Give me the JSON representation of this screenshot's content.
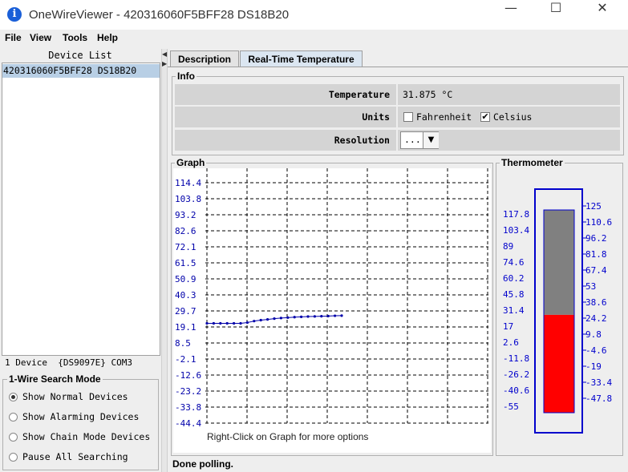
{
  "window": {
    "title": "OneWireViewer - 420316060F5BFF28 DS18B20",
    "icon_glyph": "i",
    "minimize_glyph": "—",
    "maximize_glyph": "☐",
    "close_glyph": "✕"
  },
  "menu": [
    "File",
    "View",
    "Tools",
    "Help"
  ],
  "device_list": {
    "header": "Device List",
    "items": [
      "420316060F5BFF28 DS18B20"
    ],
    "status": "1 Device  {DS9097E} COM3"
  },
  "search_mode": {
    "title": "1-Wire Search Mode",
    "options": [
      {
        "label": "Show Normal Devices",
        "selected": true
      },
      {
        "label": "Show Alarming Devices",
        "selected": false
      },
      {
        "label": "Show Chain Mode Devices",
        "selected": false
      },
      {
        "label": "Pause All Searching",
        "selected": false
      }
    ]
  },
  "splitter": {
    "left_arrow": "◀",
    "right_arrow": "▶"
  },
  "tabs": [
    {
      "label": "Description",
      "active": false
    },
    {
      "label": "Real-Time Temperature",
      "active": true
    }
  ],
  "info": {
    "title": "Info",
    "temperature_label": "Temperature",
    "temperature_value": "31.875 °C",
    "units_label": "Units",
    "fahrenheit_label": "Fahrenheit",
    "fahrenheit_checked": false,
    "celsius_label": "Celsius",
    "celsius_checked": true,
    "check_glyph": "✔",
    "resolution_label": "Resolution",
    "resolution_value": "...",
    "dropdown_glyph": "▼"
  },
  "graph": {
    "title": "Graph",
    "hint": "Right-Click on Graph for more options",
    "line_color": "#0000aa"
  },
  "chart_data": {
    "type": "line",
    "title": "",
    "xlabel": "",
    "ylabel": "",
    "y_tick_labels": [
      "114.4",
      "103.8",
      "93.2",
      "82.6",
      "72.1",
      "61.5",
      "50.9",
      "40.3",
      "29.7",
      "19.1",
      "8.5",
      "-2.1",
      "-12.6",
      "-23.2",
      "-33.8",
      "-44.4"
    ],
    "ylim": [
      -44.4,
      114.4
    ],
    "grid": true,
    "series": [
      {
        "values": [
          21.5,
          21.5,
          21.5,
          21.5,
          21.5,
          21.5,
          22.0,
          23.0,
          23.6,
          24.1,
          24.6,
          25.0,
          25.3,
          25.6,
          25.8,
          26.0,
          26.1,
          26.2,
          26.3,
          26.5,
          26.6
        ]
      }
    ]
  },
  "thermometer": {
    "title": "Thermometer",
    "left_scale": [
      "117.8",
      "103.4",
      "89",
      "74.6",
      "60.2",
      "45.8",
      "31.4",
      "17",
      "2.6",
      "-11.8",
      "-26.2",
      "-40.6",
      "-55"
    ],
    "right_scale": [
      "125",
      "110.6",
      "96.2",
      "81.8",
      "67.4",
      "53",
      "38.6",
      "24.2",
      "9.8",
      "-4.6",
      "-19",
      "-33.4",
      "-47.8"
    ],
    "min": -55,
    "max": 125,
    "value": 31.875,
    "fill_color": "#ff0000",
    "empty_color": "#808080",
    "frame_color": "#0000cc"
  },
  "status": "Done polling."
}
